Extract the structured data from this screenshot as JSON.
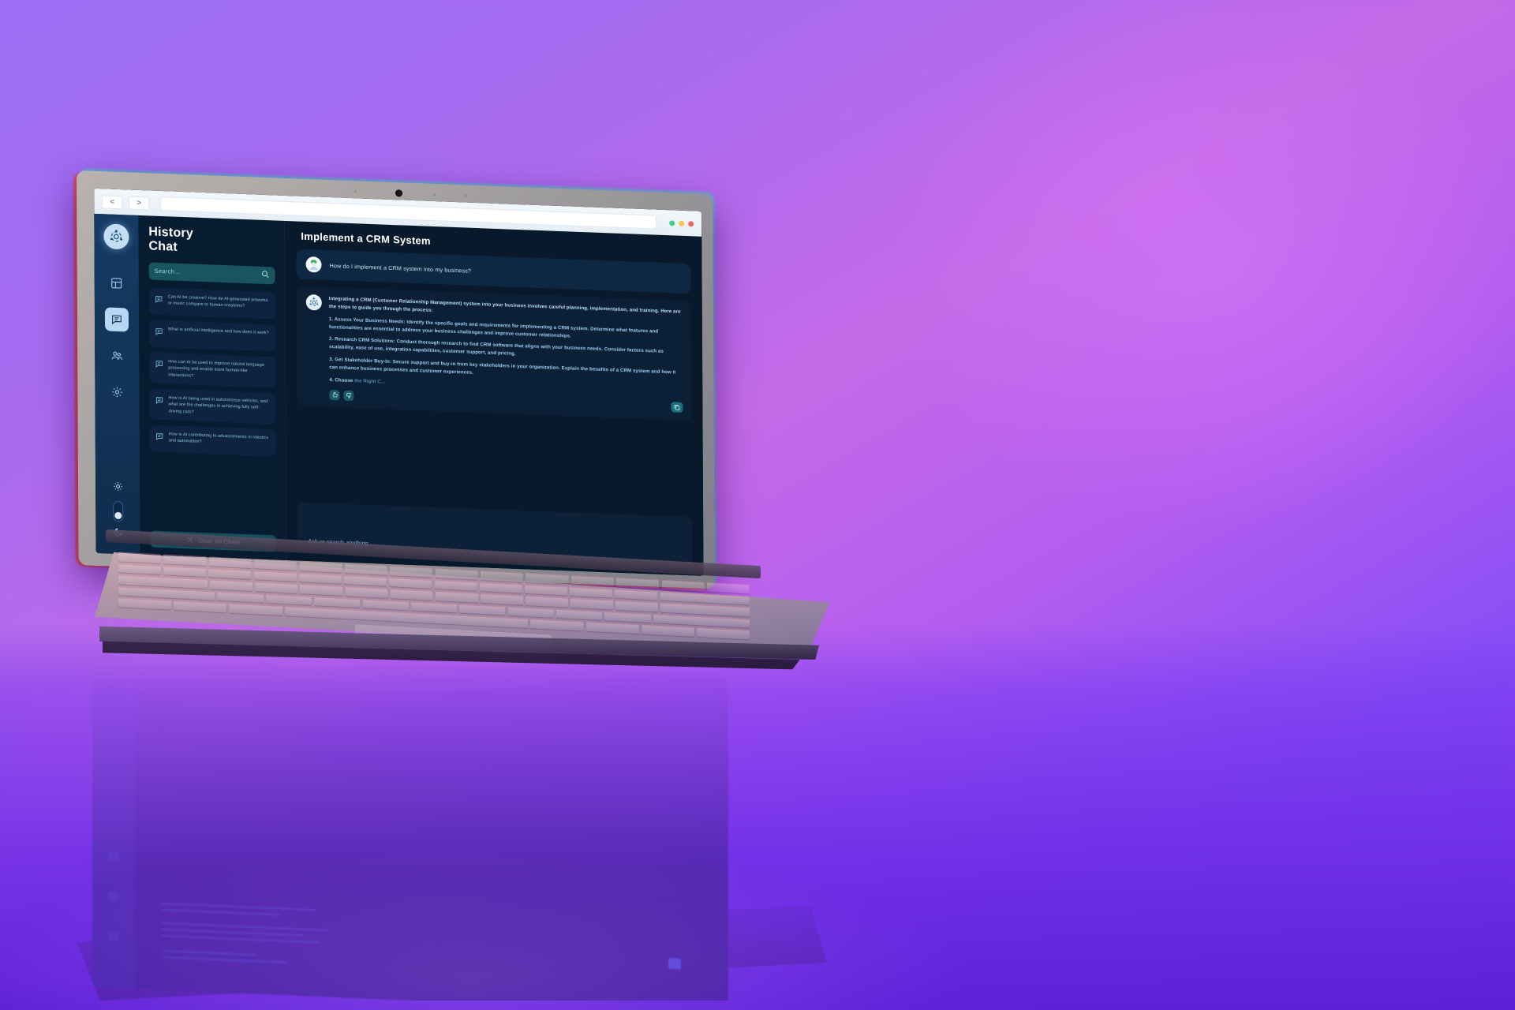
{
  "browser": {
    "back_label": "<",
    "forward_label": ">",
    "url_value": "",
    "window_dots": [
      "green",
      "yellow",
      "red"
    ]
  },
  "rail": {
    "brand_icon": "ai-logo-icon",
    "items": [
      {
        "icon": "dashboard-icon",
        "name": "sidebar-item-dashboard",
        "active": false
      },
      {
        "icon": "chat-icon",
        "name": "sidebar-item-chat",
        "active": true
      },
      {
        "icon": "community-icon",
        "name": "sidebar-item-community",
        "active": false
      },
      {
        "icon": "gear-icon",
        "name": "sidebar-item-settings",
        "active": false
      }
    ],
    "theme": {
      "light_icon": "sun-icon",
      "dark_icon": "moon-icon"
    }
  },
  "history": {
    "title_line1": "History",
    "title_line2": "Chat",
    "search_placeholder": "Search...",
    "search_icon": "search-icon",
    "items": [
      {
        "text": "Can AI be creative? How do AI-generated artworks or music compare to human creations?"
      },
      {
        "text": "What is artificial intelligence and how does it work?"
      },
      {
        "text": "How can AI be used to improve natural language processing and enable more human-like interactions?"
      },
      {
        "text": "How is AI being used in autonomous vehicles, and what are the challenges in achieving fully self-driving cars?"
      },
      {
        "text": "How is AI contributing to advancements in robotics and automation?"
      }
    ],
    "clear_label": "Clear All Chats",
    "clear_icon": "close-icon"
  },
  "main": {
    "page_title": "Implement a CRM System",
    "user_message": {
      "avatar": "user-avatar",
      "text": "How do I implement a CRM system into my business?"
    },
    "ai_message": {
      "avatar": "ai-avatar",
      "intro": "Integrating a CRM (Customer Relationship Management) system into your business involves careful planning, implementation, and training. Here are the steps to guide you through the process:",
      "steps": [
        "1. Assess Your Business Needs: Identify the specific goals and requirements for implementing a CRM system. Determine what features and functionalities are essential to address your business challenges and improve customer relationships.",
        "2. Research CRM Solutions: Conduct thorough research to find CRM software that aligns with your business needs. Consider factors such as scalability, ease of use, integration capabilities, customer support, and pricing.",
        "3. Get Stakeholder Buy-In: Secure support and buy-in from key stakeholders in your organization. Explain the benefits of a CRM system and how it can enhance business processes and customer experiences."
      ],
      "streaming_label": "4. Choose",
      "streaming_faded": " the Right C...",
      "actions": [
        {
          "icon": "thumbs-up-icon",
          "name": "like-button"
        },
        {
          "icon": "thumbs-down-icon",
          "name": "dislike-button"
        }
      ],
      "copy_icon": "copy-icon"
    },
    "composer_placeholder": "Ask or search anything..."
  },
  "colors": {
    "accent_teal": "#1d6e7c",
    "panel_dark": "#0b1f37",
    "rail_blue": "#123357",
    "text_blue": "#9ed0ef",
    "background_purple": "#9b6ef5"
  }
}
